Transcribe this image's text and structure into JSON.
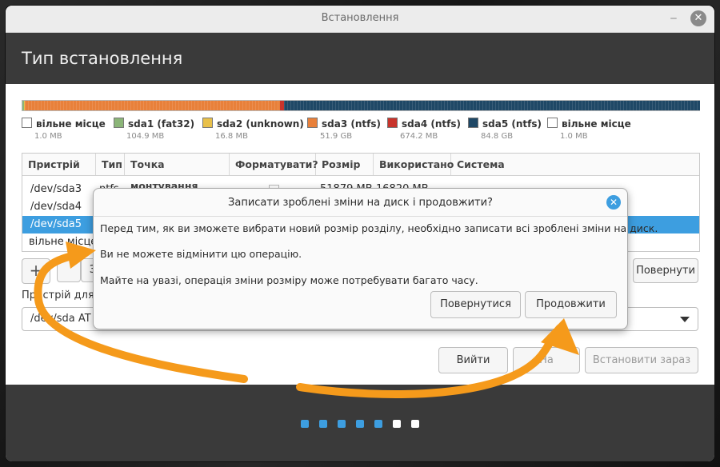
{
  "window": {
    "title": "Встановлення",
    "minimize_icon": "minimize-icon",
    "close_icon": "close-icon"
  },
  "header": {
    "title": "Тип встановлення"
  },
  "disk_bar": {
    "segments": [
      {
        "name": "sda1 (fat32)",
        "color": "#8bb578",
        "fraction": 0.002
      },
      {
        "name": "sda2 (unknown)",
        "color": "#e8c04a",
        "fraction": 0.0003
      },
      {
        "name": "sda3 (ntfs)",
        "color": "#e8803a",
        "fraction": 0.378
      },
      {
        "name": "sda4 (ntfs)",
        "color": "#c8342c",
        "fraction": 0.005
      },
      {
        "name": "sda5 (ntfs)",
        "color": "#1f4866",
        "fraction": 0.615
      }
    ]
  },
  "legend": [
    {
      "label": "вільне місце",
      "size": "1.0 MB",
      "color": "#ffffff"
    },
    {
      "label": "sda1 (fat32)",
      "size": "104.9 MB",
      "color": "#8bb578"
    },
    {
      "label": "sda2 (unknown)",
      "size": "16.8 MB",
      "color": "#e8c04a"
    },
    {
      "label": "sda3 (ntfs)",
      "size": "51.9 GB",
      "color": "#e8803a"
    },
    {
      "label": "sda4 (ntfs)",
      "size": "674.2 MB",
      "color": "#c8342c"
    },
    {
      "label": "sda5 (ntfs)",
      "size": "84.8 GB",
      "color": "#1f4866"
    },
    {
      "label": "вільне місце",
      "size": "1.0 MB",
      "color": "#ffffff"
    }
  ],
  "table": {
    "columns": [
      "Пристрій",
      "Тип",
      "Точка монтування",
      "Форматувати?",
      "Розмір",
      "Використано",
      "Система"
    ],
    "rows": [
      {
        "device": "/dev/sda3",
        "type": "ntfs",
        "size": "51879 MB",
        "used": "16820 MB"
      },
      {
        "device": "/dev/sda4",
        "type": "",
        "size": "",
        "used": ""
      },
      {
        "device": "/dev/sda5",
        "type": "",
        "size": "",
        "used": "",
        "selected": true
      },
      {
        "device": "вільне місце",
        "type": "",
        "size": "",
        "used": ""
      }
    ]
  },
  "toolbar": {
    "add_icon": "plus-icon",
    "change_label": "З",
    "revert_label": "Повернути"
  },
  "bootloader": {
    "label": "Пристрій для в",
    "value": "/dev/sda   AT"
  },
  "nav": {
    "quit_label": "Вийти",
    "back_label": "На",
    "install_label": "Встановити зараз"
  },
  "progress": {
    "total_steps": 7,
    "completed_steps": 5,
    "active_color": "#3d9ee0",
    "inactive_color": "#ffffff"
  },
  "dialog": {
    "title": "Записати зроблені зміни на диск і продовжити?",
    "line1": "Перед тим, як ви зможете вибрати новий розмір розділу, необхідно записати всі зроблені зміни на диск.",
    "line2": "Ви не можете відмінити цю операцію.",
    "line3": "Майте на увазі, операція зміни розміру може потребувати багато часу.",
    "back_label": "Повернутися",
    "continue_label": "Продовжити",
    "close_icon": "close-icon"
  },
  "annotation": {
    "color": "#f59a1b"
  }
}
